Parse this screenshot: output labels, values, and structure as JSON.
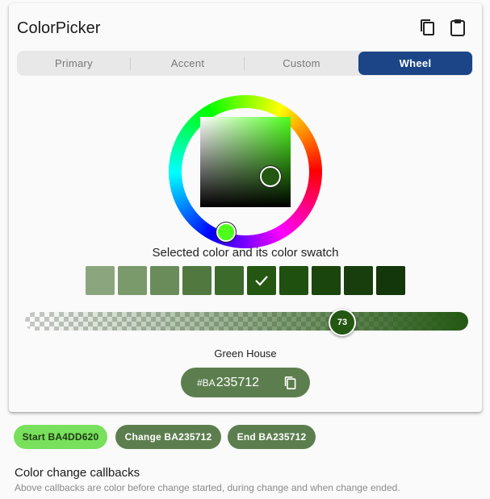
{
  "app": {
    "title": "ColorPicker"
  },
  "header": {
    "copy_icon": "copy-icon",
    "paste_icon": "paste-icon"
  },
  "tabs": [
    {
      "label": "Primary"
    },
    {
      "label": "Accent"
    },
    {
      "label": "Custom"
    },
    {
      "label": "Wheel",
      "active": true
    }
  ],
  "picker": {
    "caption": "Selected color and its color swatch",
    "swatches": [
      "#8ba67f",
      "#7a9a6c",
      "#6a8c5b",
      "#51793f",
      "#3b6a2b",
      "#235712",
      "#1f5010",
      "#1a460e",
      "#173e0c",
      "#13360a"
    ],
    "selected_swatch_index": 5,
    "opacity_label": "73",
    "color_name": "Green House",
    "hex_prefix": "#BA",
    "hex_value": "235712",
    "accent": "#1b4586"
  },
  "callbacks": {
    "start": "Start BA4DD620",
    "change": "Change BA235712",
    "end": "End BA235712",
    "title": "Color change callbacks",
    "subtitle": "Above callbacks are color before change started, during change and when change ended."
  }
}
